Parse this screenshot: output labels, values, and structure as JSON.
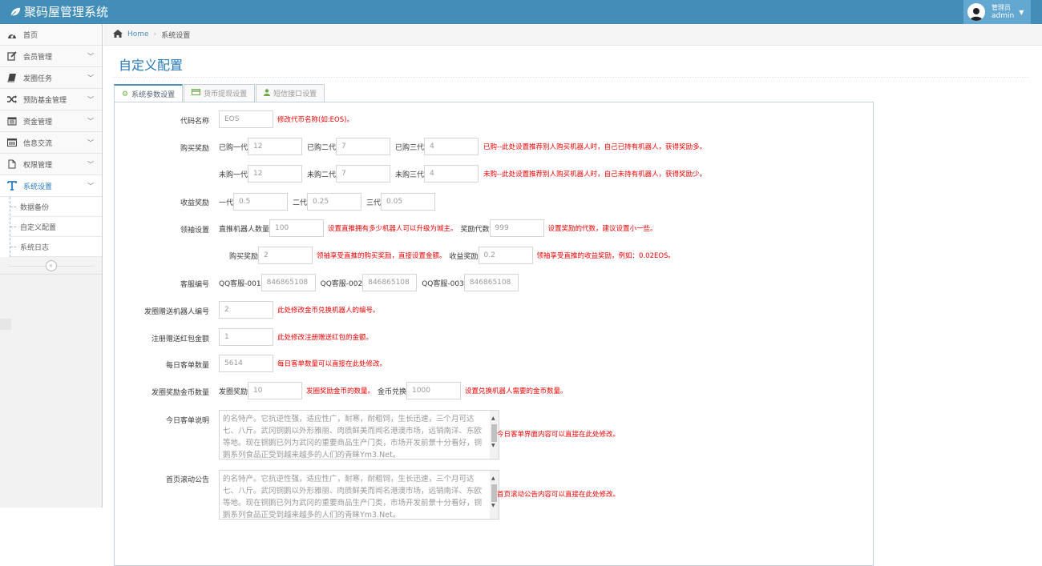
{
  "app": {
    "title": "聚码屋管理系统"
  },
  "user": {
    "role": "管理员",
    "name": "admin"
  },
  "sidebar": {
    "items": [
      {
        "label": "首页",
        "icon": "dashboard-icon",
        "has_children": false
      },
      {
        "label": "会员管理",
        "icon": "edit-icon",
        "has_children": true
      },
      {
        "label": "发圈任务",
        "icon": "book-icon",
        "has_children": true
      },
      {
        "label": "预防基金管理",
        "icon": "random-icon",
        "has_children": true
      },
      {
        "label": "资金管理",
        "icon": "calendar-icon",
        "has_children": true
      },
      {
        "label": "信息交流",
        "icon": "list-alt-icon",
        "has_children": true
      },
      {
        "label": "权限管理",
        "icon": "file-icon",
        "has_children": true
      },
      {
        "label": "系统设置",
        "icon": "text-width-icon",
        "has_children": true,
        "active": true
      }
    ],
    "sub_items": [
      {
        "label": "数据备份"
      },
      {
        "label": "自定义配置"
      },
      {
        "label": "系统日志"
      }
    ],
    "collapse_label": "«"
  },
  "breadcrumb": {
    "home": "Home",
    "current": "系统设置"
  },
  "page": {
    "title": "自定义配置"
  },
  "tabs": [
    {
      "label": "系统参数设置",
      "icon": "cogs-icon",
      "active": true
    },
    {
      "label": "货币提现设置",
      "icon": "credit-card-icon"
    },
    {
      "label": "短信接口设置",
      "icon": "user-icon"
    }
  ],
  "form": {
    "code_name": {
      "label": "代码名称",
      "value": "EOS",
      "hint": "修改代币名称(如:EOS)。"
    },
    "buy_reward": {
      "label": "购买奖励",
      "bought": {
        "l1": "已购一代",
        "v1": "12",
        "l2": "已购二代",
        "v2": "7",
        "l3": "已购三代",
        "v3": "4",
        "hint": "已购--此处设置推荐别人购买机器人时，自己已持有机器人，获得奖励多。"
      },
      "unbought": {
        "l1": "未购一代",
        "v1": "12",
        "l2": "未购二代",
        "v2": "7",
        "l3": "未购三代",
        "v3": "4",
        "hint": "未购--此处设置推荐别人购买机器人时，自己未持有机器人，获得奖励少。"
      }
    },
    "income_reward": {
      "label": "收益奖励",
      "l1": "一代",
      "v1": "0.5",
      "l2": "二代",
      "v2": "0.25",
      "l3": "三代",
      "v3": "0.05"
    },
    "leader": {
      "label": "领袖设置",
      "direct_label": "直推机器人数量",
      "direct_value": "100",
      "direct_hint": "设置直推拥有多少机器人可以升级为城主。",
      "gen_label": "奖励代数",
      "gen_value": "999",
      "gen_hint": "设置奖励的代数，建议设置小一些。",
      "buy_label": "购买奖励",
      "buy_value": "2",
      "buy_hint": "领袖享受直推的购买奖励，直接设置金额。",
      "income_label": "收益奖励",
      "income_value": "0.2",
      "income_hint": "领袖享受直推的收益奖励，例如：0.02EOS。"
    },
    "service": {
      "label": "客服编号",
      "l1": "QQ客服-001",
      "v1": "846865108",
      "l2": "QQ客服-002",
      "v2": "846865108",
      "l3": "QQ客服-003",
      "v3": "846865108"
    },
    "gift_robot": {
      "label": "发圈赠送机器人编号",
      "value": "2",
      "hint": "此处修改金币兑换机器人的编号。"
    },
    "reg_bonus": {
      "label": "注册赠送红包金额",
      "value": "1",
      "hint": "此处修改注册赠送红包的金额。"
    },
    "daily_orders": {
      "label": "每日客单数量",
      "value": "5614",
      "hint": "每日客单数量可以直接在此处修改。"
    },
    "circle_coins": {
      "label": "发圈奖励金币数量",
      "reward_label": "发圈奖励",
      "reward_value": "10",
      "reward_hint": "发圈奖励金币的数量。",
      "exchange_label": "金币兑换",
      "exchange_value": "1000",
      "exchange_hint": "设置兑换机器人需要的金币数量。"
    },
    "daily_desc": {
      "label": "今日客单说明",
      "value": "的名特产。它抗逆性强，适应性广，耐寒，耐粗饲，生长迅速，三个月可达七、八斤。武冈铜鹅以外形雅丽、肉质鲜美而闻名港澳市场，远销南洋、东欧等地。现在铜鹅已列为武冈的重要商品生产门类，市场开发前景十分看好，铜鹅系列食品正受到越来越多的人们的青睐Ym3.Net。",
      "hint": "今日客单界面内容可以直接在此处修改。"
    },
    "notice": {
      "label": "首页滚动公告",
      "value": "的名特产。它抗逆性强，适应性广，耐寒，耐粗饲，生长迅速，三个月可达七、八斤。武冈铜鹅以外形雅丽、肉质鲜美而闻名港澳市场，远销南洋、东欧等地。现在铜鹅已列为武冈的重要商品生产门类，市场开发前景十分看好，铜鹅系列食品正受到越来越多的人们的青睐Ym3.Net。",
      "hint": "首页滚动公告内容可以直接在此处修改。"
    }
  }
}
